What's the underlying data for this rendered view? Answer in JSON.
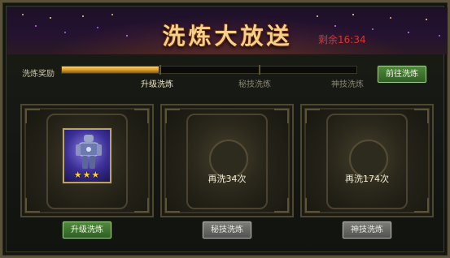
{
  "header": {
    "title": "洗炼大放送",
    "timer": "剩余16:34"
  },
  "progress": {
    "label": "洗炼奖励",
    "fill_fraction": 0.33,
    "milestones": [
      "升级洗炼",
      "秘技洗炼",
      "神技洗炼"
    ],
    "goto_button": "前往洗炼"
  },
  "panels": [
    {
      "status": "",
      "stars": "★★★",
      "button": "升级洗炼"
    },
    {
      "status": "再洗34次",
      "button": "秘技洗炼"
    },
    {
      "status": "再洗174次",
      "button": "神技洗炼"
    }
  ],
  "colors": {
    "accent_green": "#3f7a2e",
    "title_gold": "#f4d08a",
    "timer_red": "#e0322a",
    "progress_gold": "#d59a23"
  }
}
